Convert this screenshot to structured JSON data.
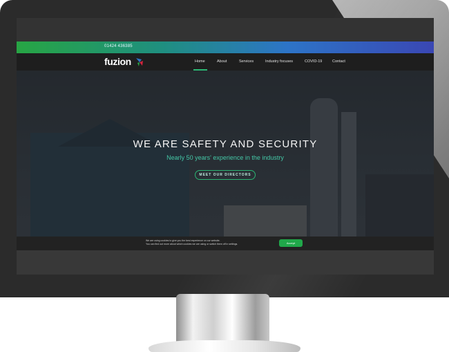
{
  "site": {
    "phone": "01424 436385",
    "logo_text": "fuzion"
  },
  "nav": {
    "items": [
      {
        "label": "Home",
        "active": true
      },
      {
        "label": "About",
        "active": false
      },
      {
        "label": "Services",
        "active": false
      },
      {
        "label": "Industry focuses",
        "active": false
      },
      {
        "label": "COVID-19",
        "active": false
      },
      {
        "label": "Contact",
        "active": false
      }
    ]
  },
  "hero": {
    "title": "WE ARE SAFETY AND SECURITY",
    "subtitle": "Nearly 50 years' experience in the industry",
    "button_label": "MEET OUR DIRECTORS"
  },
  "cookie": {
    "line1": "We are using cookies to give you the best experience on our website.",
    "line2": "You can find out more about which cookies we are using or switch them off in settings.",
    "accept_label": "Accept"
  },
  "colors": {
    "accent_green": "#2bb673",
    "topbar_start": "#27a544",
    "topbar_end": "#3a47b4"
  }
}
